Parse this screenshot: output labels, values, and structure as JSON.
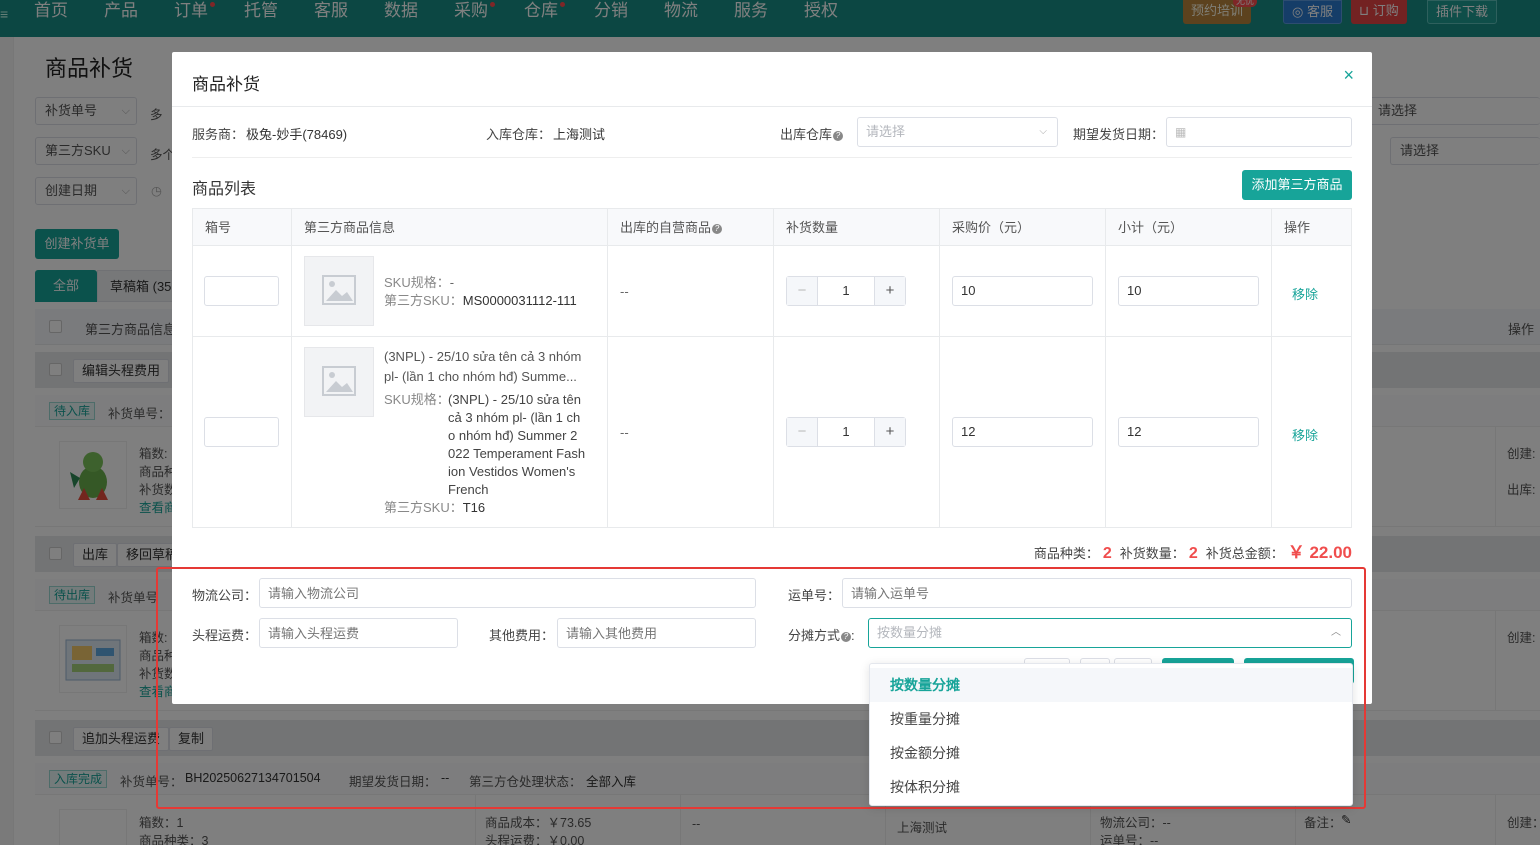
{
  "nav": {
    "items": [
      {
        "label": "首页",
        "dot": false
      },
      {
        "label": "产品",
        "dot": false
      },
      {
        "label": "订单",
        "dot": true
      },
      {
        "label": "托管",
        "dot": false
      },
      {
        "label": "客服",
        "dot": false
      },
      {
        "label": "数据",
        "dot": false
      },
      {
        "label": "采购",
        "dot": true
      },
      {
        "label": "仓库",
        "dot": true
      },
      {
        "label": "分销",
        "dot": false
      },
      {
        "label": "物流",
        "dot": false
      },
      {
        "label": "服务",
        "dot": false
      },
      {
        "label": "授权",
        "dot": false
      }
    ],
    "training_label": "预约培训",
    "training_badge": "无忧",
    "service_label": "客服",
    "order_label": "订购",
    "plugin_label": "插件下载"
  },
  "bg": {
    "page_title": "商品补货",
    "filter_no": "补货单号",
    "filter_no_hint": "多",
    "filter_sku": "第三方SKU",
    "filter_sku_hint": "多个",
    "filter_date": "创建日期",
    "right_sel_1": "请选择",
    "right_sel_2": "请选择",
    "create_btn": "创建补货单",
    "tab_all": "全部",
    "tab_draft": "草稿箱 (35",
    "col_product": "第三方商品信息",
    "col_ops": "操作",
    "group1_btn1": "编辑头程费用",
    "group1_tag": "待入库",
    "group1_no_label": "补货单号：",
    "group1_l1": "箱数:",
    "group1_l2": "商品种",
    "group1_l3": "补货数",
    "group1_link": "查看商",
    "group1_r1": "创建:",
    "group1_r2": "出库:",
    "group2_btn1": "出库",
    "group2_btn2": "移回草稿",
    "group2_tag": "待出库",
    "group2_no_label": "补货单号",
    "group2_l1": "箱数:",
    "group2_l2": "商品种",
    "group2_l3": "补货数",
    "group2_link": "查看商",
    "group2_r1": "创建:",
    "group3_btn1": "追加头程运费",
    "group3_btn2": "复制",
    "group3_tag": "入库完成",
    "group3_no_label": "补货单号：",
    "group3_no": "BH20250627134701504",
    "group3_expect_label": "期望发货日期：",
    "group3_expect": "--",
    "group3_state_label": "第三方仓处理状态：",
    "group3_state": "全部入库",
    "group3_boxes": "箱数：1",
    "group3_kinds": "商品种类：3",
    "group3_cost": "商品成本：￥73.65",
    "group3_freight": "头程运费：￥0.00",
    "group3_dash": "--",
    "group3_wh": "上海测试",
    "group3_logistics": "物流公司：--",
    "group3_waybill": "运单号：--",
    "group3_remark": "备注：",
    "group3_created": "创建："
  },
  "modal": {
    "title": "商品补货",
    "provider_label": "服务商：",
    "provider_value": "极兔-妙手(78469)",
    "in_wh_label": "入库仓库：",
    "in_wh_value": "上海测试",
    "out_wh_label": "出库仓库",
    "out_wh_placeholder": "请选择",
    "expect_date_label": "期望发货日期：",
    "list_title": "商品列表",
    "add_btn": "添加第三方商品",
    "columns": [
      "箱号",
      "第三方商品信息",
      "出库的自营商品",
      "补货数量",
      "采购价（元）",
      "小计（元）",
      "操作"
    ],
    "rows": [
      {
        "name_lines": [],
        "sku_spec_label": "SKU规格：",
        "sku_spec": "-",
        "sku_label": "第三方SKU：",
        "sku": "MS0000031112-111",
        "self_product": "--",
        "qty": "1",
        "price": "10",
        "subtotal": "10",
        "action": "移除"
      },
      {
        "name_lines": [
          "(3NPL) - 25/10 sửa tên cả 3 nhóm",
          "pl- (lần 1 cho nhóm hđ) Summe..."
        ],
        "sku_spec_label": "SKU规格：",
        "sku_spec_lines": [
          "(3NPL) - 25/10 sửa tên",
          "cả 3 nhóm pl- (lần 1 ch",
          "o nhóm hđ) Summer 2",
          "022 Temperament Fash",
          "ion Vestidos Women's",
          "French"
        ],
        "sku_label": "第三方SKU：",
        "sku": "T16",
        "self_product": "--",
        "qty": "1",
        "price": "12",
        "subtotal": "12",
        "action": "移除"
      }
    ],
    "summary_kinds_label": "商品种类：",
    "summary_kinds": "2",
    "summary_qty_label": "补货数量：",
    "summary_qty": "2",
    "summary_amount_label": "补货总金额：",
    "summary_amount": "￥ 22.00",
    "logistics_label": "物流公司：",
    "logistics_placeholder": "请输入物流公司",
    "waybill_label": "运单号：",
    "waybill_placeholder": "请输入运单号",
    "freight_label": "头程运费：",
    "freight_placeholder": "请输入头程运费",
    "other_fee_label": "其他费用：",
    "other_fee_placeholder": "请输入其他费用",
    "alloc_label": "分摊方式",
    "alloc_placeholder": "按数量分摊",
    "alloc_options": [
      "按数量分摊",
      "按重量分摊",
      "按金额分摊",
      "按体积分摊"
    ],
    "alloc_selected_index": 0
  },
  "colors": {
    "accent": "#17a499",
    "nav": "#188f86",
    "danger": "#f04d4d",
    "highlight_border": "#e53935"
  }
}
